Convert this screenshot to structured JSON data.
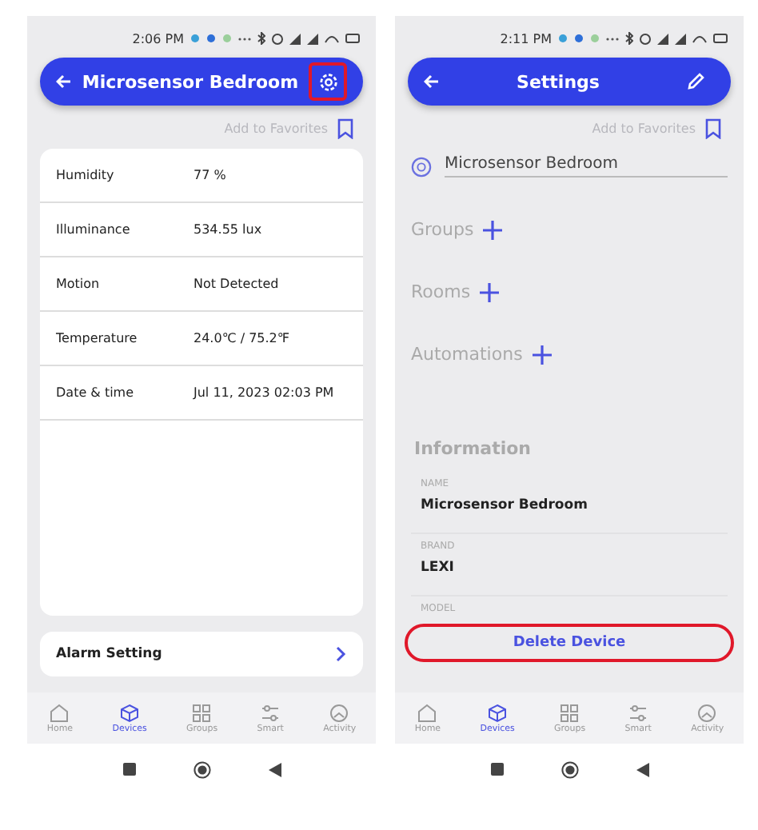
{
  "screens": [
    {
      "kind": "detail",
      "status_time": "2:06 PM",
      "title": "Microsensor Bedroom",
      "action": {
        "kind": "gear",
        "highlighted": true
      },
      "favorites": "Add to Favorites",
      "rows": [
        {
          "label": "Humidity",
          "value": "77 %"
        },
        {
          "label": "Illuminance",
          "value": "534.55 lux"
        },
        {
          "label": "Motion",
          "value": "Not Detected"
        },
        {
          "label": "Temperature",
          "value": "24.0℃ / 75.2℉"
        },
        {
          "label": "Date & time",
          "value": "Jul 11, 2023 02:03 PM"
        }
      ],
      "alarm": "Alarm Setting",
      "tabs": [
        {
          "label": "Home",
          "selected": false
        },
        {
          "label": "Devices",
          "selected": true
        },
        {
          "label": "Groups",
          "selected": false
        },
        {
          "label": "Smart",
          "selected": false
        },
        {
          "label": "Activity",
          "selected": false
        }
      ]
    },
    {
      "kind": "settings",
      "status_time": "2:11 PM",
      "title": "Settings",
      "action": {
        "kind": "pencil",
        "highlighted": false
      },
      "favorites": "Add to Favorites",
      "device_name": "Microsensor Bedroom",
      "sections": [
        "Groups",
        "Rooms",
        "Automations"
      ],
      "info_title": "Information",
      "info": [
        {
          "label": "NAME",
          "value": "Microsensor Bedroom"
        },
        {
          "label": "BRAND",
          "value": "LEXI"
        },
        {
          "label": "MODEL"
        }
      ],
      "delete": "Delete Device",
      "delete_highlighted": true,
      "tabs": [
        {
          "label": "Home",
          "selected": false
        },
        {
          "label": "Devices",
          "selected": true
        },
        {
          "label": "Groups",
          "selected": false
        },
        {
          "label": "Smart",
          "selected": false
        },
        {
          "label": "Activity",
          "selected": false
        }
      ]
    }
  ]
}
